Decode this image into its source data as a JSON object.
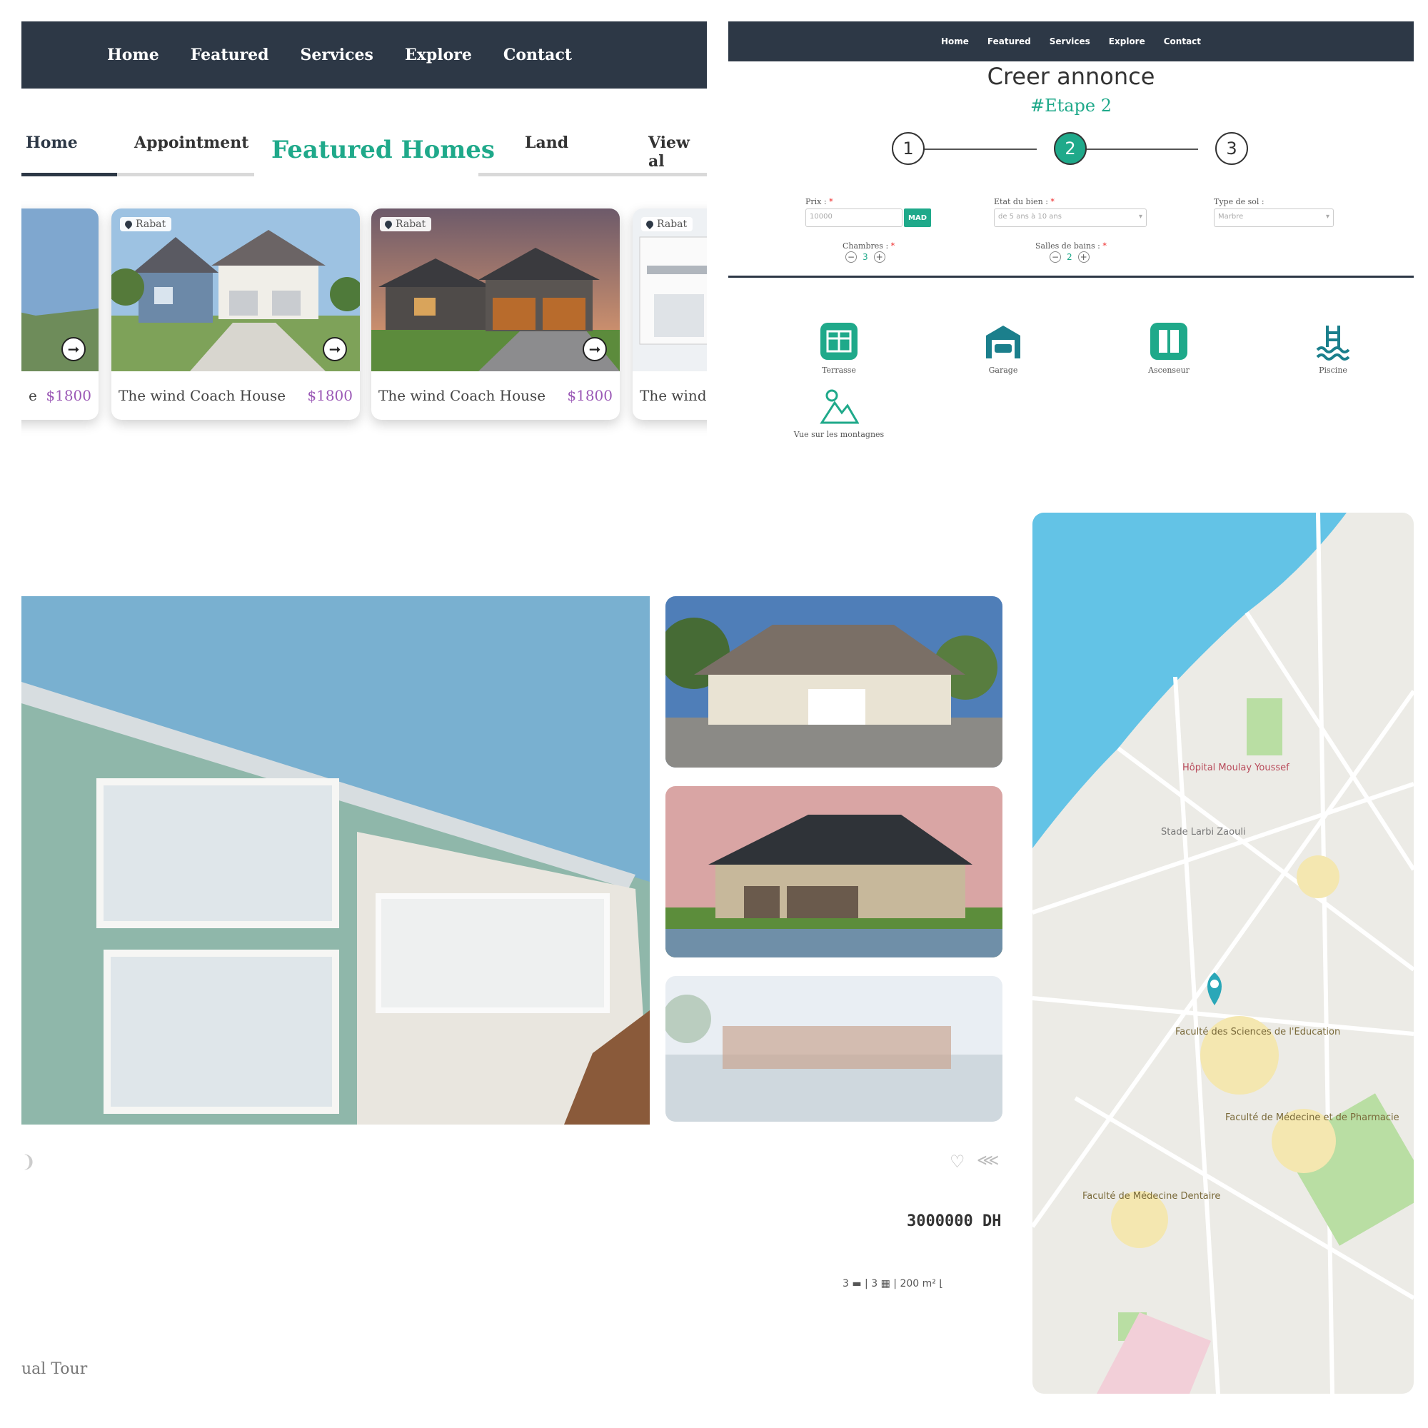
{
  "featured_panel": {
    "nav": [
      "Home",
      "Featured",
      "Services",
      "Explore",
      "Contact"
    ],
    "tabs": {
      "home": "Home",
      "appointment": "Appointment",
      "title": "Featured Homes",
      "land": "Land",
      "view_all": "View al"
    },
    "cards": [
      {
        "location": "",
        "name": "e",
        "price": "$1800"
      },
      {
        "location": "Rabat",
        "name": "The wind Coach House",
        "price": "$1800"
      },
      {
        "location": "Rabat",
        "name": "The wind Coach House",
        "price": "$1800"
      },
      {
        "location": "Rabat",
        "name": "The wind",
        "price": ""
      }
    ],
    "colors": {
      "nav_bg": "#2d3846",
      "accent": "#1fa98a",
      "price": "#9b59b6"
    }
  },
  "form_panel": {
    "nav": [
      "Home",
      "Featured",
      "Services",
      "Explore",
      "Contact"
    ],
    "title": "Creer annonce",
    "step_label": "#Etape 2",
    "steps": [
      "1",
      "2",
      "3"
    ],
    "active_step": 2,
    "fields": {
      "prix_label": "Prix :",
      "prix_placeholder": "10000",
      "currency": "MAD",
      "etat_label": "Etat du bien :",
      "etat_value": "de 5 ans à 10 ans",
      "type_sol_label": "Type de sol :",
      "type_sol_value": "Marbre",
      "chambres_label": "Chambres :",
      "chambres_value": "3",
      "salles_label": "Salles de bains :",
      "salles_value": "2",
      "required_mark": "*"
    },
    "amenities": [
      {
        "label": "Terrasse",
        "icon": "terrace-icon"
      },
      {
        "label": "Garage",
        "icon": "garage-icon"
      },
      {
        "label": "Ascenseur",
        "icon": "elevator-icon"
      },
      {
        "label": "Piscine",
        "icon": "pool-icon"
      },
      {
        "label": "Vue sur les montagnes",
        "icon": "mountain-view-icon"
      }
    ]
  },
  "listing_panel": {
    "price": "3000000 DH",
    "specs": {
      "beds": "3",
      "baths": "3",
      "area": "200 m²"
    },
    "virtual_tour": "ual Tour"
  },
  "map_panel": {
    "labels": [
      "Hôpital Moulay Youssef",
      "Stade Larbi Zaouli",
      "Faculté des Sciences de l'Education",
      "Faculté de Médecine et de Pharmacie",
      "Faculté de Médecine Dentaire"
    ]
  }
}
